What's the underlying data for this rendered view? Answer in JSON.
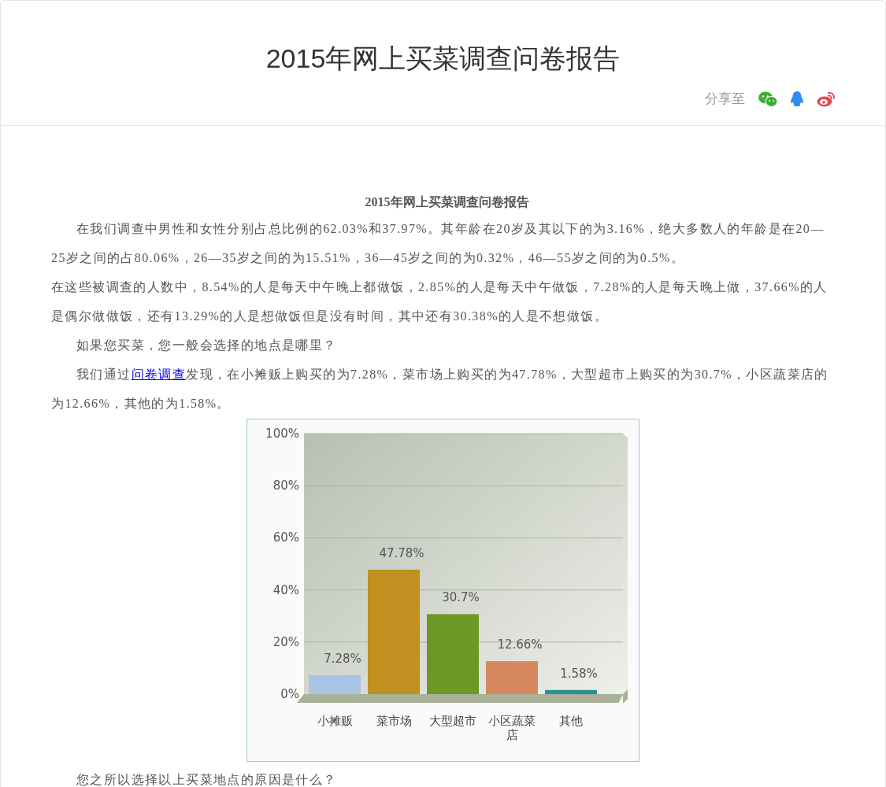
{
  "header": {
    "title": "2015年网上买菜调查问卷报告",
    "share_label": "分享至"
  },
  "article": {
    "title": "2015年网上买菜调查问卷报告",
    "blocks": [
      {
        "kind": "paragraph",
        "indent": true,
        "text": "在我们调查中男性和女性分别占总比例的62.03%和37.97%。其年龄在20岁及其以下的为3.16%，绝大多数人的年龄是在20—25岁之间的占80.06%，26—35岁之间的为15.51%，36—45岁之间的为0.32%，46—55岁之间的为0.5%。"
      },
      {
        "kind": "paragraph",
        "indent": false,
        "text": "在这些被调查的人数中，8.54%的人是每天中午晚上都做饭，2.85%的人是每天中午做饭，7.28%的人是每天晚上做，37.66%的人是偶尔做做饭，还有13.29%的人是想做饭但是没有时间，其中还有30.38%的人是不想做饭。"
      },
      {
        "kind": "paragraph",
        "indent": true,
        "text": "如果您买菜，您一般会选择的地点是哪里？"
      },
      {
        "kind": "link_paragraph",
        "indent": true,
        "before": "我们通过",
        "link": "问卷调查",
        "after": "发现，在小摊贩上购买的为7.28%，菜市场上购买的为47.78%，大型超市上购买的为30.7%，小区蔬菜店的为12.66%，其他的为1.58%。"
      },
      {
        "kind": "chart",
        "chart_data": {
          "type": "bar",
          "categories": [
            "小摊贩",
            "菜市场",
            "大型超市",
            "小区蔬菜店",
            "其他"
          ],
          "series": [
            {
              "values": [
                7.28,
                47.78,
                30.7,
                12.66,
                1.58
              ]
            }
          ],
          "colors": [
            "#a8c4e4",
            "#c09020",
            "#6c9828",
            "#d88860",
            "#289098"
          ],
          "grid": true,
          "ylim": [
            0,
            100
          ],
          "yticks": [
            {
              "value": 0,
              "label": "0%"
            },
            {
              "value": 20,
              "label": "20%"
            },
            {
              "value": 40,
              "label": "40%"
            },
            {
              "value": 60,
              "label": "60%"
            },
            {
              "value": 80,
              "label": "80%"
            },
            {
              "value": 100,
              "label": "100%"
            }
          ],
          "value_labels": [
            "7.28%",
            "47.78%",
            "30.7%",
            "12.66%",
            "1.58%"
          ]
        }
      },
      {
        "kind": "paragraph",
        "indent": true,
        "text": "您之所以选择以上买菜地点的原因是什么？"
      }
    ]
  }
}
